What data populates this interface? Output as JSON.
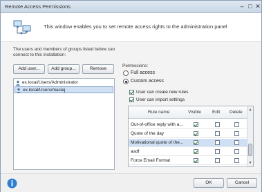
{
  "window": {
    "title": "Remote Access Permissions"
  },
  "header": {
    "message": "This window enables you to set remote access rights to the administration panel"
  },
  "users_section": {
    "intro": "The users and members of groups listed below can connect to this installation:",
    "add_user_label": "Add user...",
    "add_group_label": "Add group...",
    "remove_label": "Remove",
    "items": [
      {
        "label": "ex.local/Users/Administrator",
        "selected": false
      },
      {
        "label": "ex.local/Users/maciej",
        "selected": true
      }
    ]
  },
  "permissions": {
    "label": "Permissions:",
    "full_access_label": "Full access",
    "custom_access_label": "Custom access",
    "full_access_selected": false,
    "custom_access_selected": true,
    "create_rules_label": "User can create new rules",
    "create_rules_checked": true,
    "import_settings_label": "User can import settings",
    "import_settings_checked": true
  },
  "rules_table": {
    "columns": [
      "Rule name",
      "Visible",
      "Edit",
      "Delete"
    ],
    "rows": [
      {
        "name": "Out-of-office reply with a...",
        "visible": true,
        "edit": false,
        "delete": false,
        "selected": false
      },
      {
        "name": "Quote of the day",
        "visible": true,
        "edit": false,
        "delete": false,
        "selected": false
      },
      {
        "name": "Motivational quote of the...",
        "visible": true,
        "edit": false,
        "delete": false,
        "selected": true
      },
      {
        "name": "asdf",
        "visible": true,
        "edit": false,
        "delete": false,
        "selected": false
      },
      {
        "name": "Force Email Format",
        "visible": true,
        "edit": false,
        "delete": false,
        "selected": false
      }
    ]
  },
  "footer": {
    "ok_label": "OK",
    "cancel_label": "Cancel"
  },
  "colors": {
    "selection": "#cfe0f5",
    "accent": "#2f7fd0"
  }
}
